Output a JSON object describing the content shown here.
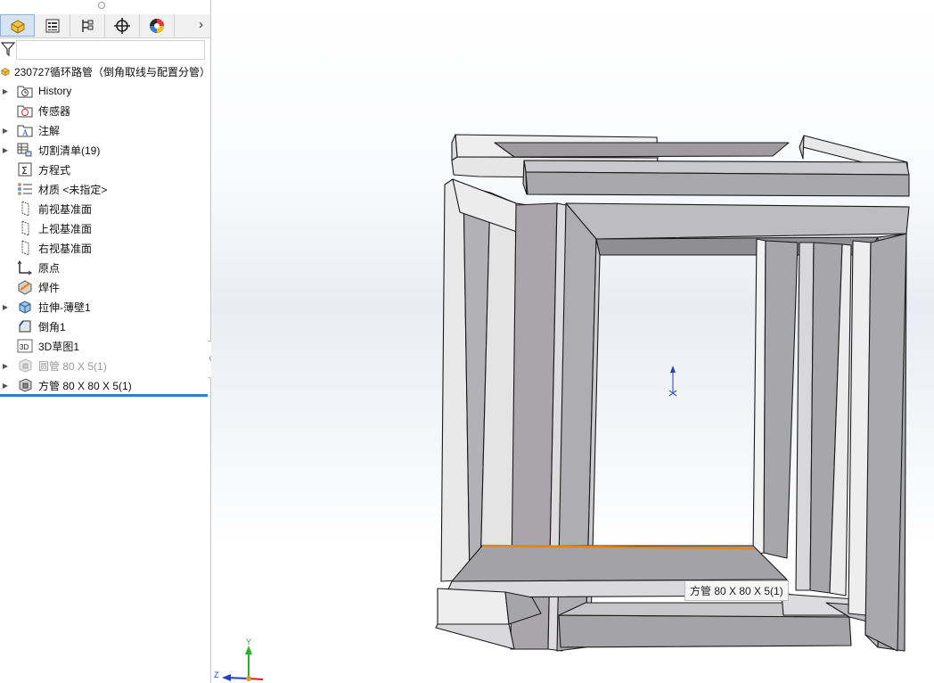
{
  "tree": {
    "root_label": "230727循环路管（倒角取线与配置分管）",
    "items": [
      {
        "label": "History",
        "expandable": true,
        "icon": "history-folder-icon",
        "dim": false
      },
      {
        "label": "传感器",
        "expandable": false,
        "icon": "sensor-folder-icon",
        "dim": false
      },
      {
        "label": "注解",
        "expandable": true,
        "icon": "annotation-folder-icon",
        "dim": false
      },
      {
        "label": "切割清单(19)",
        "expandable": true,
        "icon": "cut-list-icon",
        "dim": false
      },
      {
        "label": "方程式",
        "expandable": false,
        "icon": "equations-icon",
        "dim": false
      },
      {
        "label": "材质 <未指定>",
        "expandable": false,
        "icon": "material-icon",
        "dim": false
      },
      {
        "label": "前视基准面",
        "expandable": false,
        "icon": "plane-icon",
        "dim": false
      },
      {
        "label": "上视基准面",
        "expandable": false,
        "icon": "plane-icon",
        "dim": false
      },
      {
        "label": "右视基准面",
        "expandable": false,
        "icon": "plane-icon",
        "dim": false
      },
      {
        "label": "原点",
        "expandable": false,
        "icon": "origin-icon",
        "dim": false
      },
      {
        "label": "焊件",
        "expandable": false,
        "icon": "weldment-icon",
        "dim": false
      },
      {
        "label": "拉伸-薄壁1",
        "expandable": true,
        "icon": "extrude-thin-icon",
        "dim": false
      },
      {
        "label": "倒角1",
        "expandable": false,
        "icon": "chamfer-icon",
        "dim": false
      },
      {
        "label": "3D草图1",
        "expandable": false,
        "icon": "3d-sketch-icon",
        "dim": false
      },
      {
        "label": "圆管 80 X 5(1)",
        "expandable": true,
        "icon": "structural-member-icon",
        "dim": true
      },
      {
        "label": "方管 80 X 80 X 5(1)",
        "expandable": true,
        "icon": "structural-member-icon",
        "dim": false
      }
    ]
  },
  "tabs": [
    {
      "name": "feature-manager-tab",
      "icon": "part-icon"
    },
    {
      "name": "property-manager-tab",
      "icon": "property-icon"
    },
    {
      "name": "configuration-manager-tab",
      "icon": "configuration-icon"
    },
    {
      "name": "dimxpert-tab",
      "icon": "crosshair-icon"
    },
    {
      "name": "display-manager-tab",
      "icon": "color-wheel-icon"
    }
  ],
  "viewport": {
    "tooltip": "方管 80 X 80 X 5(1)",
    "triad": {
      "x": "X",
      "y": "Y",
      "z": "Z"
    },
    "colors": {
      "tube_face": "#a8a6aa",
      "tube_light": "#e4e4e6",
      "edge": "#1a1a1a",
      "highlight": "#e8820e"
    }
  }
}
